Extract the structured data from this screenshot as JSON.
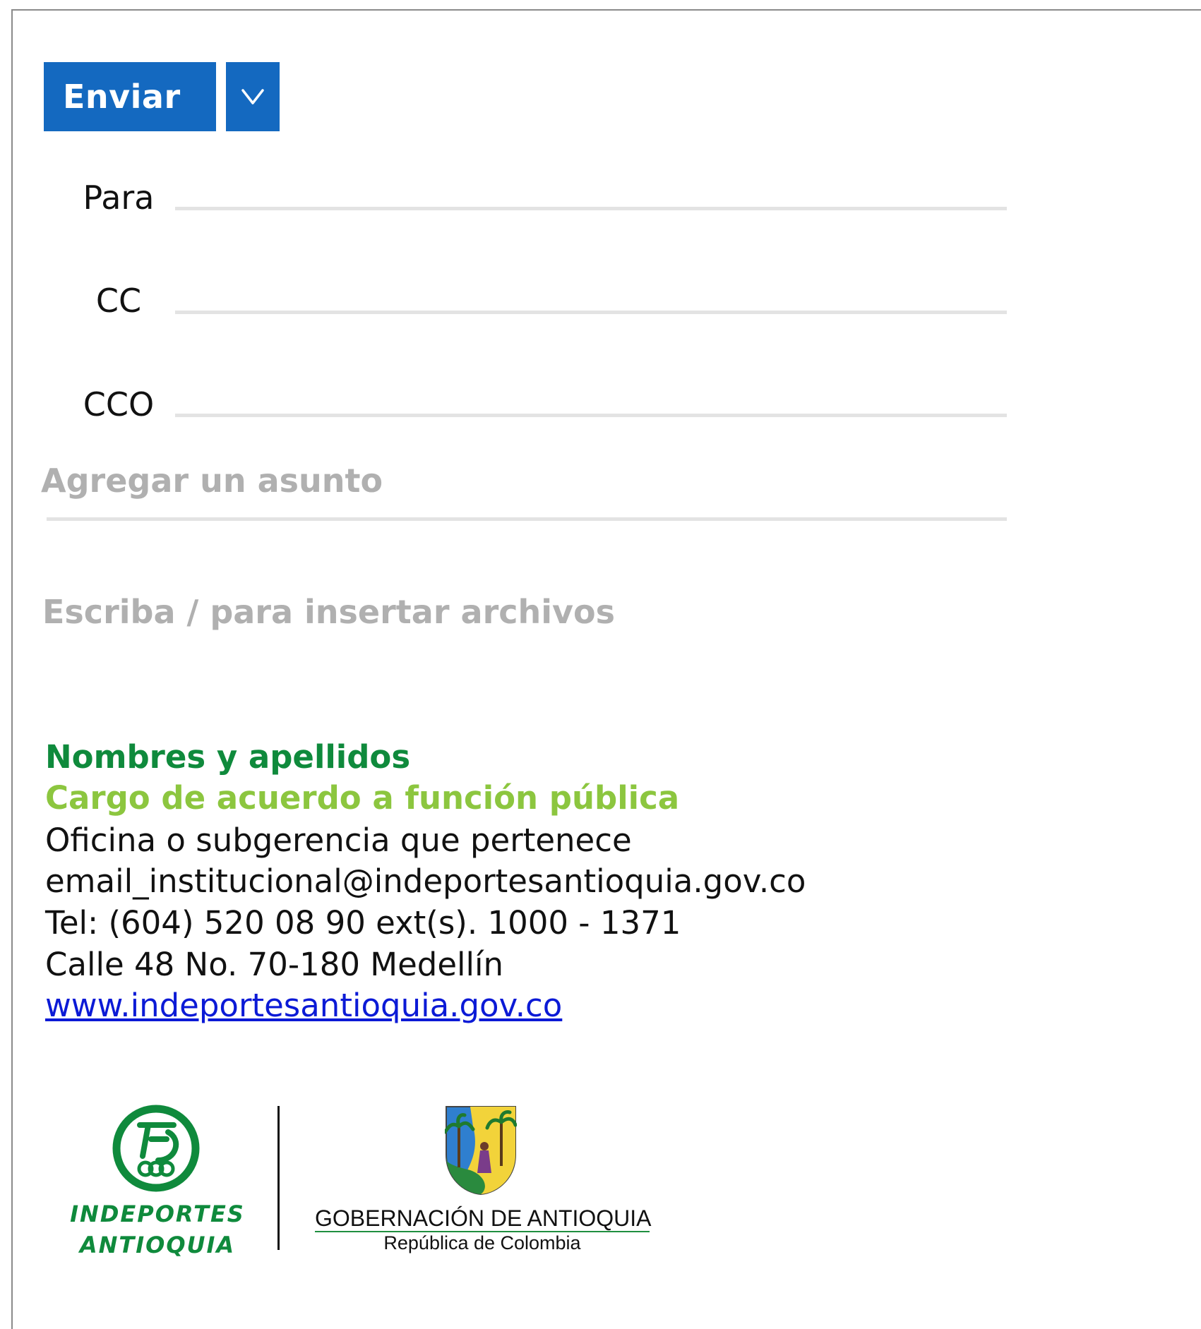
{
  "compose": {
    "send_label": "Enviar",
    "options_icon": "chevron-down-icon",
    "fields": {
      "to_label": "Para",
      "cc_label": "CC",
      "bcc_label": "CCO"
    },
    "subject_placeholder": "Agregar un asunto",
    "body_placeholder": "Escriba / para insertar archivos"
  },
  "signature": {
    "name": "Nombres y apellidos",
    "role": "Cargo de acuerdo a función pública",
    "office": "Oficina o subgerencia que pertenece",
    "email": "email_institucional@indeportesantioquia.gov.co",
    "phone": "Tel: (604) 520 08 90 ext(s). 1000 - 1371",
    "address": "Calle 48 No. 70-180 Medellín",
    "website": "www.indeportesantioquia.gov.co"
  },
  "logos": {
    "indeportes_line1": "INDEPORTES",
    "indeportes_line2": "ANTIOQUIA",
    "gov_title": "GOBERNACIÓN DE ANTIOQUIA",
    "gov_subtitle": "República de Colombia"
  },
  "colors": {
    "primary_button": "#1469c0",
    "signature_name": "#0f8a3c",
    "signature_role": "#8cc63f",
    "link": "#0b1ad6",
    "placeholder": "#b0b0b0"
  }
}
